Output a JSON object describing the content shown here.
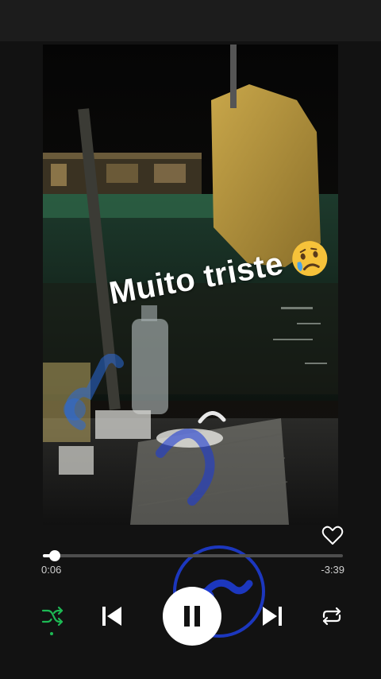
{
  "video": {
    "caption": "Muito triste",
    "emoji": "sad-but-relieved-face"
  },
  "player": {
    "liked": false,
    "progress_fraction": 0.0385,
    "elapsed": "0:06",
    "remaining": "-3:39",
    "shuffle_on": true,
    "is_playing": true
  },
  "colors": {
    "accent": "#1db954",
    "watermark": "#1e3cd2",
    "background": "#121212"
  },
  "icons": {
    "like": "heart-outline-icon",
    "shuffle": "shuffle-icon",
    "previous": "skip-previous-icon",
    "play_pause": "pause-icon",
    "next": "skip-next-icon",
    "repeat": "repeat-icon"
  }
}
